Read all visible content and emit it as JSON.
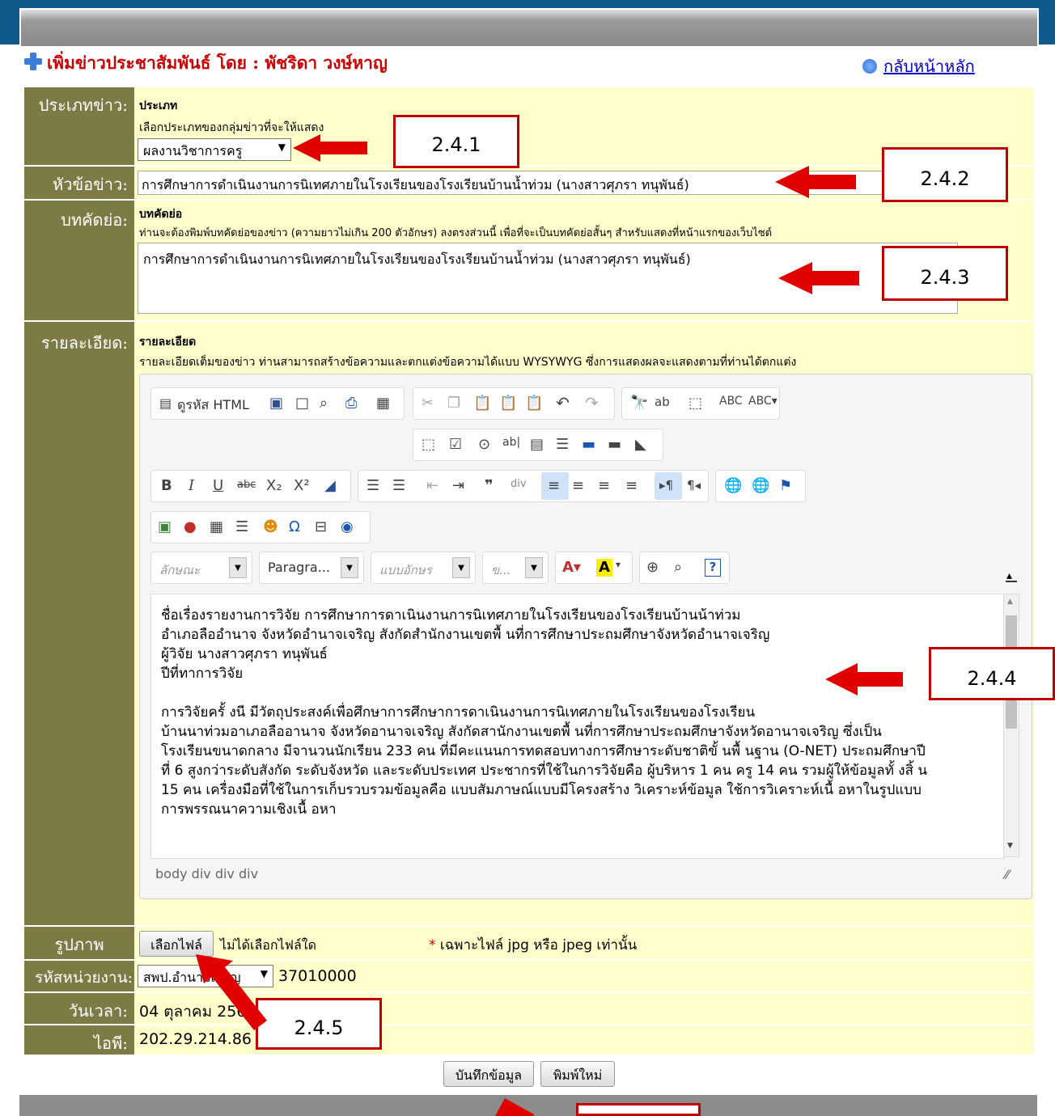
{
  "heading": {
    "title": "เพิ่มข่าวประชาสัมพันธ์ โดย : พัชริดา วงษ์หาญ",
    "back_link": "กลับหน้าหลัก"
  },
  "type_row": {
    "label": "ประเภทข่าว:",
    "title": "ประเภท",
    "desc": "เลือกประเภทของกลุ่มข่าวที่จะให้แสดง",
    "selected": "ผลงานวิชาการครู"
  },
  "headline_row": {
    "label": "หัวข้อข่าว:",
    "value": "การศึกษาการดำเนินงานการนิเทศภายในโรงเรียนของโรงเรียนบ้านน้ำท่วม (นางสาวศุภรา ทนุพันธ์)"
  },
  "summary_row": {
    "label": "บทคัดย่อ:",
    "title": "บทคัดย่อ",
    "desc": "ท่านจะต้องพิมพ์บทคัดย่อของข่าว (ความยาวไม่เกิน 200 ตัวอักษร) ลงตรงส่วนนี้ เพื่อที่จะเป็นบทคัดย่อสั้นๆ สำหรับแสดงที่หน้าแรกของเว็บไซต์",
    "value": "การศึกษาการดำเนินงานการนิเทศภายในโรงเรียนของโรงเรียนบ้านน้ำท่วม (นางสาวศุภรา ทนุพันธ์)"
  },
  "detail_row": {
    "label": "รายละเอียด:",
    "title": "รายละเอียด",
    "desc": "รายละเอียดเต็มของข่าว ท่านสามารถสร้างข้อความและตกแต่งข้อความได้แบบ WYSYWYG ซึ่งการแสดงผลจะแสดงตามที่ท่านได้ตกแต่ง",
    "toolbar": {
      "source_label": "ดูรหัส HTML",
      "style_ph": "ลักษณะ",
      "format": "Paragra...",
      "font_ph": "แบบอักษร",
      "size_ph": "ข..."
    },
    "content_lines": [
      "ชื่อเรื่องรายงานการวิจัย การศึกษาการดาเนินงานการนิเทศภายในโรงเรียนของโรงเรียนบ้านน้าท่วม",
      "อำเภอลืออำนาจ จังหวัดอำนาจเจริญ สังกัดสำนักงานเขตพื้ นที่การศึกษาประถมศึกษาจังหวัดอำนาจเจริญ",
      "ผู้วิจัย นางสาวศุภรา ทนุพันธ์",
      "ปีที่ทาการวิจัย",
      "",
      "การวิจัยครั้ งนี มีวัตถุประสงค์เพื่อศึกษาการศึกษาการดาเนินงานการนิเทศภายในโรงเรียนของโรงเรียน",
      "บ้านนาท่วมอาเภอลืออานาจ จังหวัดอานาจเจริญ สังกัดสานักงานเขตพื้ นที่การศึกษาประถมศึกษาจังหวัดอานาจเจริญ ซึ่งเป็น",
      "โรงเรียนขนาดกลาง มีจานวนนักเรียน 233 คน ที่มีคะแนนการทดสอบทางการศึกษาระดับชาติขั้ นพื้ นฐาน (O-NET) ประถมศึกษาปี",
      "ที่ 6 สูงกว่าระดับสังกัด ระดับจังหวัด และระดับประเทศ ประชากรที่ใช้ในการวิจัยคือ ผู้บริหาร 1 คน ครู 14 คน รวมผู้ให้ข้อมูลทั้ งสิ้ น",
      "15 คน เครื่องมือที่ใช้ในการเก็บรวบรวมข้อมูลคือ แบบสัมภาษณ์แบบมีโครงสร้าง วิเคราะห์ข้อมูล ใช้การวิเคราะห์เนื้ อหาในรูปแบบ",
      "การพรรณนาความเชิงเนื้ อหา"
    ],
    "path": "body div div div"
  },
  "image_row": {
    "label": "รูปภาพ",
    "choose_btn": "เลือกไฟล์",
    "no_file": "ไม่ได้เลือกไฟล์ใด",
    "star": "*",
    "note": "เฉพาะไฟล์ jpg หรือ jpeg เท่านั้น"
  },
  "unit_row": {
    "label": "รหัสหน่วยงาน:",
    "selected": "สพป.อำนาจเจริญ",
    "code": "37010000"
  },
  "date_row": {
    "label": "วันเวลา:",
    "value": "04 ตุลาคม 2561"
  },
  "ip_row": {
    "label": "ไอพี:",
    "value": "202.29.214.86"
  },
  "buttons": {
    "save": "บันทึกข้อมูล",
    "reset": "พิมพ์ใหม่"
  },
  "callouts": {
    "c1": "2.4.1",
    "c2": "2.4.2",
    "c3": "2.4.3",
    "c4": "2.4.4",
    "c5": "2.4.5"
  }
}
